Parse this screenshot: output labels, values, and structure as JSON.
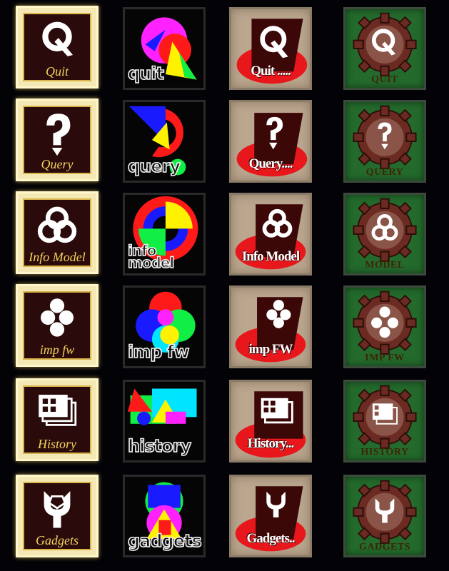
{
  "icons": [
    {
      "id": "quit",
      "gold": "Quit",
      "neon": "quit",
      "tan": "Quit .....",
      "gear": "QUIT"
    },
    {
      "id": "query",
      "gold": "Query",
      "neon": "query",
      "tan": "Query....",
      "gear": "QUERY"
    },
    {
      "id": "info",
      "gold": "Info Model",
      "neon": "info model",
      "tan": "Info Model",
      "gear": "MODEL"
    },
    {
      "id": "impfw",
      "gold": "imp fw",
      "neon": "imp fw",
      "tan": "imp FW",
      "gear": "IMP FW"
    },
    {
      "id": "history",
      "gold": "History",
      "neon": "history",
      "tan": "History...",
      "gear": "HISTORY"
    },
    {
      "id": "gadgets",
      "gold": "Gadgets",
      "neon": "gadgets",
      "tan": "Gadgets..",
      "gear": "GADGETS"
    }
  ],
  "colors": {
    "gold_frame": "#f4e9b5",
    "gold_text": "#f3d35c",
    "dark_plate": "#2a0a0a",
    "tan_bg": "#bba68e",
    "red_oval": "#e8171c",
    "gear_green": "#236a2c"
  }
}
